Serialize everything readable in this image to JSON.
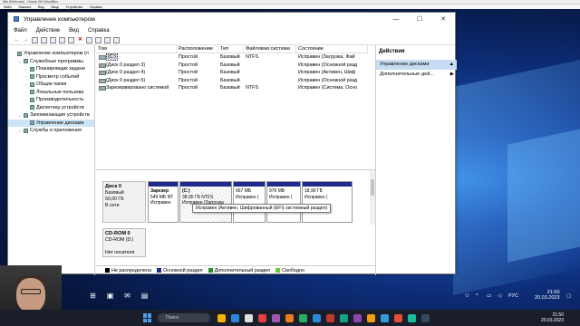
{
  "vbox": {
    "title": "Win (Работает) - Oracle VM VirtualBox",
    "menu": [
      "Файл",
      "Машина",
      "Вид",
      "Ввод",
      "Устройства",
      "Справка"
    ]
  },
  "window": {
    "title": "Управление компьютером",
    "menu": [
      "Файл",
      "Действие",
      "Вид",
      "Справка"
    ]
  },
  "tree": [
    {
      "label": "Управление компьютером (л",
      "indent": 0,
      "exp": ""
    },
    {
      "label": "Служебные программы",
      "indent": 1,
      "exp": "⌄"
    },
    {
      "label": "Планировщик задани",
      "indent": 2,
      "exp": "›"
    },
    {
      "label": "Просмотр событий",
      "indent": 2,
      "exp": "›"
    },
    {
      "label": "Общие папки",
      "indent": 2,
      "exp": "›"
    },
    {
      "label": "Локальные пользова",
      "indent": 2,
      "exp": "›"
    },
    {
      "label": "Производительность",
      "indent": 2,
      "exp": "›"
    },
    {
      "label": "Диспетчер устройств",
      "indent": 2,
      "exp": ""
    },
    {
      "label": "Запоминающие устройств",
      "indent": 1,
      "exp": "⌄"
    },
    {
      "label": "Управление дисками",
      "indent": 2,
      "exp": "",
      "selected": true
    },
    {
      "label": "Службы и приложения",
      "indent": 1,
      "exp": "›"
    }
  ],
  "list": {
    "headers": [
      "Том",
      "Расположение",
      "Тип",
      "Файловая система",
      "Состояние"
    ],
    "rows": [
      [
        "(C:)",
        "Простой",
        "Базовый",
        "NTFS",
        "Исправен (Загрузка, Фай"
      ],
      [
        "(Диск 0 раздел 3)",
        "Простой",
        "Базовый",
        "",
        "Исправен (Основной разд"
      ],
      [
        "(Диск 0 раздел 4)",
        "Простой",
        "Базовый",
        "",
        "Исправен (Активен, Шиф"
      ],
      [
        "(Диск 0 раздел 5)",
        "Простой",
        "Базовый",
        "",
        "Исправен (Основной разд"
      ],
      [
        "Зарезервировано системой",
        "Простой",
        "Базовый",
        "NTFS",
        "Исправен (Система, Осно"
      ]
    ]
  },
  "actions": {
    "header": "Действия",
    "items": [
      {
        "label": "Управление дисками",
        "arrow": "▲"
      },
      {
        "label": "Дополнительные дей...",
        "arrow": "▶"
      }
    ]
  },
  "disk0": {
    "name": "Диск 0",
    "type": "Базовый",
    "size": "60,00 ГБ",
    "status": "В сети",
    "partitions": [
      {
        "l1": "Зарезер",
        "l2": "549 МБ NT",
        "l3": "Исправен",
        "bar": true,
        "w": 34
      },
      {
        "l1": "(C:)",
        "l2": "38,95 ГБ NTFS",
        "l3": "Исправен (Загрузка",
        "bar": true,
        "w": 58,
        "hatch": true
      },
      {
        "l1": "",
        "l2": "667 МБ",
        "l3": "Исправен (",
        "bar": true,
        "w": 36
      },
      {
        "l1": "",
        "l2": "976 МБ",
        "l3": "Исправен (",
        "bar": true,
        "w": 38
      },
      {
        "l1": "",
        "l2": "18,90 ГБ",
        "l3": "Исправен (",
        "bar": true,
        "w": 56
      }
    ]
  },
  "cdrom": {
    "name": "CD-ROM 0",
    "drive": "CD-ROM (D:)",
    "media": "Нет носителя"
  },
  "tooltip": "Исправен (Активен, Шифрованный (EFI) системный раздел)",
  "legend": [
    {
      "label": "Не распределена",
      "color": "#000000"
    },
    {
      "label": "Основной раздел",
      "color": "#1f2a8c"
    },
    {
      "label": "Дополнительный раздел",
      "color": "#2e8b2e"
    },
    {
      "label": "Свободно",
      "color": "#66cc33"
    }
  ],
  "guest_clock": {
    "time": "21:50",
    "date": "20.03.2023",
    "lang": "РУС"
  },
  "host": {
    "search_placeholder": "Поиск",
    "clock": {
      "time": "21:50",
      "date": "20.03.2023",
      "lang": "РУС"
    },
    "icon_colors": [
      "#f4b400",
      "#2b88d8",
      "#e0e0e0",
      "#e04040",
      "#9b59b6",
      "#e67e22",
      "#27ae60",
      "#2b88d8",
      "#c0392b",
      "#16a085",
      "#8e44ad",
      "#f39c12",
      "#3498db",
      "#e74c3c",
      "#1abc9c",
      "#34495e"
    ]
  }
}
